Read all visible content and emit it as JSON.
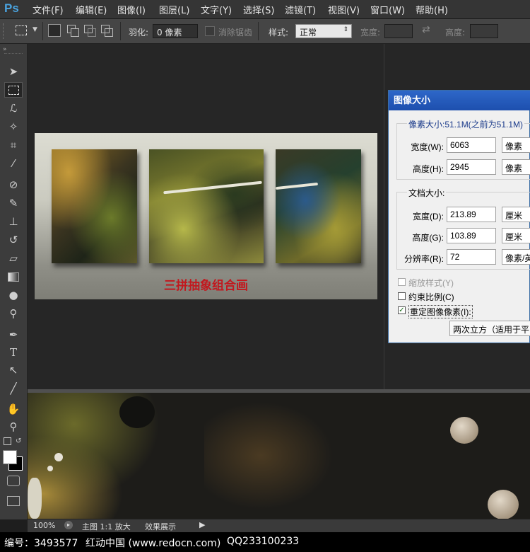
{
  "app": {
    "logo": "Ps"
  },
  "menu": [
    "文件(F)",
    "编辑(E)",
    "图像(I)",
    "图层(L)",
    "文字(Y)",
    "选择(S)",
    "滤镜(T)",
    "视图(V)",
    "窗口(W)",
    "帮助(H)"
  ],
  "options": {
    "feather_label": "羽化:",
    "feather_value": "0 像素",
    "antialias_label": "消除锯齿",
    "style_label": "样式:",
    "style_value": "正常",
    "width_label": "宽度:",
    "height_label": "高度:"
  },
  "tools": [
    "move-tool-icon",
    "marquee-tool-icon",
    "lasso-tool-icon",
    "magic-wand-icon",
    "crop-tool-icon",
    "eyedropper-icon",
    "healing-brush-icon",
    "brush-tool-icon",
    "clone-stamp-icon",
    "history-brush-icon",
    "eraser-icon",
    "gradient-tool-icon",
    "blur-tool-icon",
    "dodge-tool-icon",
    "pen-tool-icon",
    "type-tool-icon",
    "path-select-icon",
    "line-tool-icon",
    "hand-tool-icon",
    "zoom-tool-icon"
  ],
  "artboard": {
    "caption": "三拼抽象组合画"
  },
  "dialog": {
    "title": "图像大小",
    "pixel_size": "像素大小:51.1M(之前为51.1M)",
    "width_label": "宽度(W):",
    "width_value": "6063",
    "width_unit": "像素",
    "height_label": "高度(H):",
    "height_value": "2945",
    "height_unit": "像素",
    "doc_size": "文档大小:",
    "doc_width_label": "宽度(D):",
    "doc_width_value": "213.89",
    "doc_width_unit": "厘米",
    "doc_height_label": "高度(G):",
    "doc_height_value": "103.89",
    "doc_height_unit": "厘米",
    "resolution_label": "分辨率(R):",
    "resolution_value": "72",
    "resolution_unit": "像素/英",
    "scale_styles": "缩放样式(Y)",
    "constrain": "约束比例(C)",
    "resample": "重定图像像素(I):",
    "resample_method": "两次立方（适用于平"
  },
  "status": {
    "zoom": "100%",
    "doc_info": "主图 1:1 放大",
    "effect": "效果展示"
  },
  "footer": {
    "number": "编号：3493577",
    "site": "红动中国 (www.redocn.com)",
    "qq": "QQ233100233"
  }
}
